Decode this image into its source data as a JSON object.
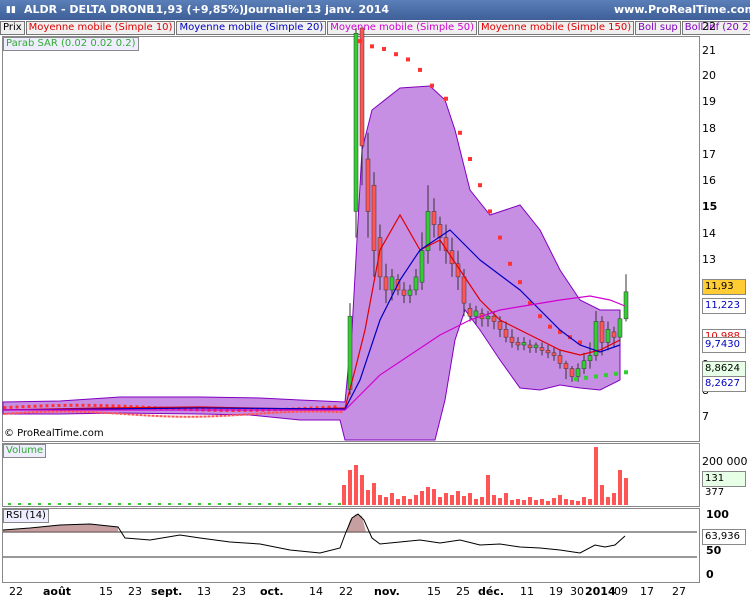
{
  "titlebar": {
    "logo_text": "ALDR - DELTA DRONE",
    "price": "11,93 (+9,85%)",
    "period": "Journalier",
    "date": "13 janv. 2014",
    "site": "www.ProRealTime.com"
  },
  "legend": [
    {
      "label": "Prix",
      "color": "#000000"
    },
    {
      "label": "Moyenne mobile (Simple 10)",
      "color": "#e00000"
    },
    {
      "label": "Moyenne mobile (Simple 20)",
      "color": "#0000c0"
    },
    {
      "label": "Moyenne mobile (Simple 50)",
      "color": "#d000d0"
    },
    {
      "label": "Moyenne mobile (Simple 150)",
      "color": "#e00000"
    },
    {
      "label": "Boll sup",
      "color": "#8000c0"
    },
    {
      "label": "Boll inf (20 2)",
      "color": "#8000c0"
    }
  ],
  "sar_label": "Parab SAR (0.02 0.02 0.2)",
  "copyright": "© ProRealTime.com",
  "volume_label": "Volume",
  "rsi_label": "RSI (14)",
  "price_axis": {
    "ticks": [
      "22",
      "21",
      "20",
      "19",
      "18",
      "17",
      "16",
      "15",
      "14",
      "13",
      "12",
      "10",
      "9",
      "8",
      "7"
    ]
  },
  "badges": [
    {
      "text": "11,93",
      "value": 11.93,
      "bg": "#ffcc33"
    },
    {
      "text": "11,223",
      "value": 11.223,
      "bg": "#ffffff"
    },
    {
      "text": "10,988",
      "value": 10.9,
      "bg": "#ffffff"
    },
    {
      "text": "9,7430",
      "value": 9.74,
      "bg": "#ffffff"
    },
    {
      "text": "8,8624",
      "value": 8.86,
      "bg": "#e6ffe6"
    },
    {
      "text": "8,2627",
      "value": 8.26,
      "bg": "#ffffff"
    }
  ],
  "volume_axis": {
    "ticks": [
      "200 000",
      "100 000"
    ],
    "badge": "131 377"
  },
  "rsi_axis": {
    "ticks": [
      "100",
      "50",
      "0"
    ],
    "badge": "63,936"
  },
  "x_axis": {
    "ticks": [
      "22",
      "août",
      "15",
      "23",
      "sept.",
      "13",
      "23",
      "oct.",
      "14",
      "22",
      "nov.",
      "15",
      "25",
      "déc.",
      "11",
      "19",
      "30",
      "2014",
      "09",
      "17",
      "27"
    ]
  },
  "colors": {
    "up": "#33cc33",
    "down": "#ff5555",
    "band": "#9933cc",
    "sar": "#ff3333",
    "sarlow": "#33cc33"
  }
}
